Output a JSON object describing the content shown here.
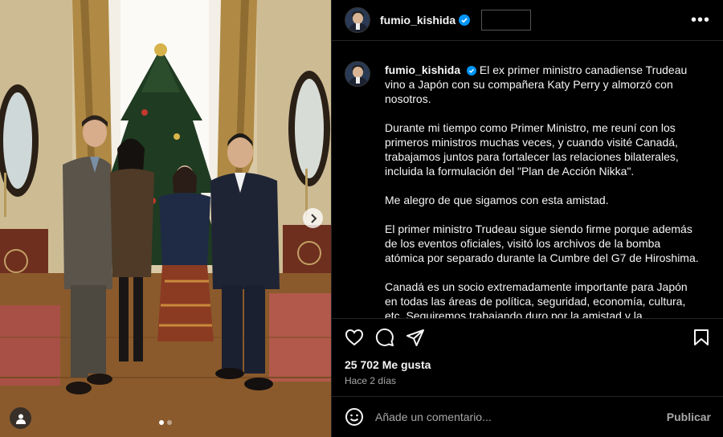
{
  "post": {
    "username": "fumio_kishida",
    "caption_paragraphs": [
      "El ex primer ministro canadiense Trudeau vino a Japón con su compañera Katy Perry y almorzó con nosotros.",
      "Durante mi tiempo como Primer Ministro, me reuní con los primeros ministros muchas veces, y cuando visité Canadá, trabajamos juntos para fortalecer las relaciones bilaterales, incluida la formulación del \"Plan de Acción Nikka\".",
      "Me alegro de que sigamos con esta amistad.",
      "El primer ministro Trudeau sigue siendo firme porque además de los eventos oficiales, visitó los archivos de la bomba atómica por separado durante la Cumbre del G7 de Hiroshima.",
      "Canadá es un socio extremadamente importante para Japón en todas las áreas de política, seguridad, economía, cultura, etc. Seguiremos trabajando duro por la amistad y la cooperación entre Japón y Canadá."
    ],
    "likes": "25 702 Me gusta",
    "date": "Hace 2 días",
    "carousel": {
      "current": 1,
      "total": 2
    }
  },
  "comment": {
    "placeholder": "Añade un comentario...",
    "publish_label": "Publicar"
  },
  "icons": {
    "more": "more-options-icon",
    "like": "heart-icon",
    "comment": "comment-icon",
    "share": "send-icon",
    "save": "bookmark-icon",
    "emoji": "emoji-icon",
    "tag": "user-tag-icon",
    "next": "chevron-right-icon"
  },
  "colors": {
    "background": "#000000",
    "text": "#f5f5f5",
    "secondary_text": "#a8a8a8",
    "verified": "#0095f6",
    "divider": "#262626"
  }
}
